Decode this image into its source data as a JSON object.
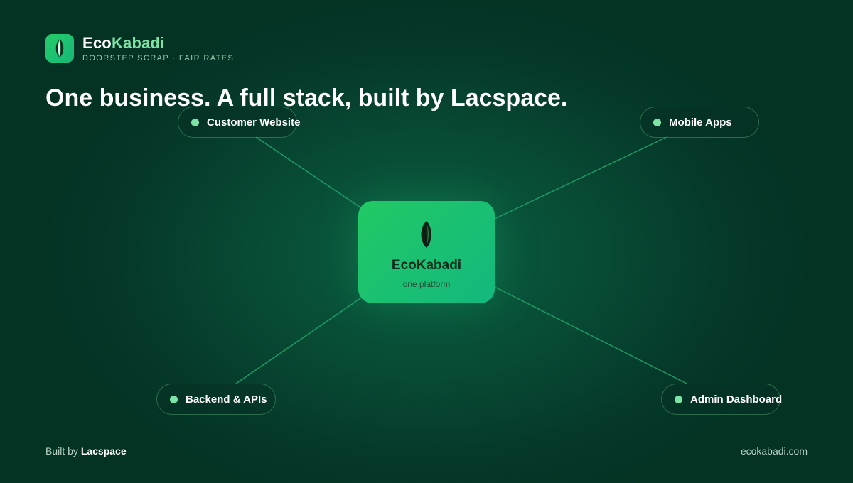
{
  "brand": {
    "name_part1": "Eco",
    "name_part2": "Kabadi",
    "tagline": "DOORSTEP SCRAP · FAIR RATES",
    "icon": "leaf-icon",
    "tile_color": "#22c964",
    "accent_color": "#7ee3a6"
  },
  "headline": "One business. A full stack, built by Lacspace.",
  "hub": {
    "title": "EcoKabadi",
    "subtitle": "one platform",
    "icon": "leaf-icon"
  },
  "nodes": {
    "customer_website": "Customer Website",
    "mobile_apps": "Mobile Apps",
    "backend_apis": "Backend & APIs",
    "admin_dashboard": "Admin Dashboard"
  },
  "footer": {
    "built_by_prefix": "Built by",
    "built_by_name": "Lacspace",
    "website": "ecokabadi.com"
  },
  "colors": {
    "background": "#084a34",
    "connector": "#1f9a63",
    "node_dot": "#7ee3a6"
  }
}
